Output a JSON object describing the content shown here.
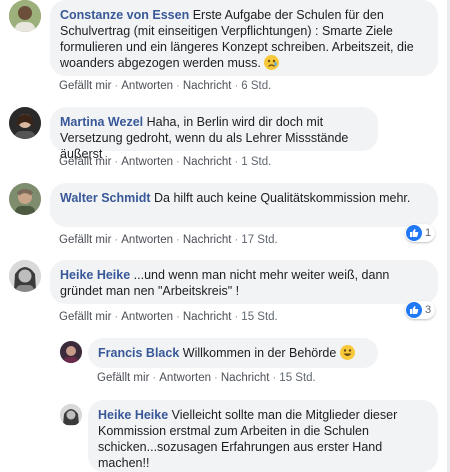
{
  "comments": [
    {
      "author": "Constanze von Essen",
      "text": "Erste Aufgabe der Schulen für den Schulvertrag (mit einseitigen Verpflichtungen) : Smarte Ziele formulieren und ein längeres Konzept schreiben. Arbeitszeit, die woanders abgezogen werden muss.",
      "emoji": "sad-face-emoji",
      "like": "Gefällt mir",
      "reply": "Antworten",
      "message": "Nachricht",
      "time": "6 Std."
    },
    {
      "author": "Martina Wezel",
      "text": "Haha, in Berlin wird dir doch mit Versetzung gedroht, wenn du als Lehrer Missstände äußerst",
      "like": "Gefällt mir",
      "reply": "Antworten",
      "message": "Nachricht",
      "time": "1 Std."
    },
    {
      "author": "Walter Schmidt",
      "text": "Da hilft auch keine Qualitätskommission mehr.",
      "like": "Gefällt mir",
      "reply": "Antworten",
      "message": "Nachricht",
      "time": "17 Std.",
      "reaction_count": "1"
    },
    {
      "author": "Heike Heike",
      "text": "...und wenn man nicht mehr weiter weiß, dann gründet man nen \"Arbeitskreis\" !",
      "like": "Gefällt mir",
      "reply": "Antworten",
      "message": "Nachricht",
      "time": "15 Std.",
      "reaction_count": "3"
    }
  ],
  "replies": [
    {
      "author": "Francis Black",
      "text": "Willkommen in der Behörde",
      "emoji": "grinning-face-emoji",
      "like": "Gefällt mir",
      "reply": "Antworten",
      "message": "Nachricht",
      "time": "15 Std."
    },
    {
      "author": "Heike Heike",
      "text": "Vielleicht sollte man die Mitglieder dieser Kommission erstmal zum Arbeiten in die Schulen schicken...sozusagen Erfahrungen aus erster Hand machen!!"
    }
  ],
  "colors": {
    "author": "#385898",
    "bubble": "#f2f3f5",
    "like_badge": "#2078f4"
  }
}
